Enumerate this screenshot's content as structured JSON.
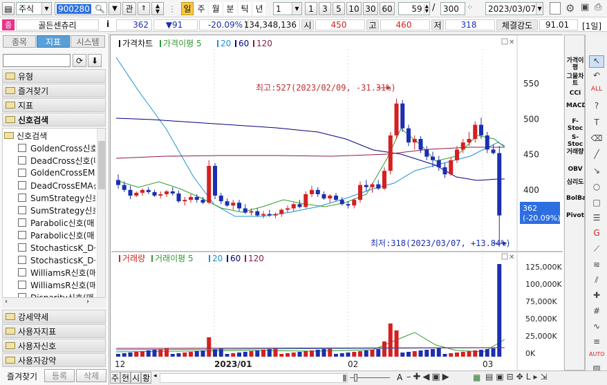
{
  "toolbar": {
    "market": "주식",
    "code": "900280",
    "btn_gwan": "관",
    "periods": [
      "일",
      "주",
      "월",
      "분",
      "틱",
      "년"
    ],
    "interval": "1",
    "quick_n": [
      "1",
      "3",
      "5",
      "10",
      "30",
      "60"
    ],
    "count": "59",
    "slash": "/",
    "total": "300",
    "date": "2023/03/07"
  },
  "quote": {
    "badge": "중",
    "name": "골든센츄리",
    "info": "i",
    "price": "362",
    "change": "▼91",
    "rate": "-20.09%",
    "volume": "134,348,136",
    "open_label": "시",
    "open": "450",
    "high_label": "고",
    "high": "460",
    "low_label": "저",
    "low": "318",
    "strength_label": "체결강도",
    "strength": "91.01",
    "period_tag": "[1일]"
  },
  "left": {
    "tabs": [
      "종목",
      "지표",
      "시스템"
    ],
    "folders_top": [
      "유형",
      "즐겨찾기",
      "지표",
      "신호검색"
    ],
    "tree_root": "신호검색",
    "tree_items": [
      "GoldenCross신호",
      "DeadCross신호(매",
      "GoldenCrossEMA",
      "DeadCrossEMA신",
      "SumStrategy신호",
      "SumStrategy신호",
      "Parabolic신호(매",
      "Parabolic신호(매",
      "StochasticsK_D신",
      "StochasticsK_D신",
      "WilliamsR신호(매",
      "WilliamsR신호(매",
      "Disparity신호(매"
    ],
    "folders_bottom": [
      "강세약세",
      "사용자지표",
      "사용자신호",
      "사용자강약"
    ],
    "bottom_tabs": [
      "즐겨찾기",
      "등록",
      "삭제"
    ]
  },
  "chart": {
    "legend_price": [
      {
        "label": "가격차트",
        "color": "#111111"
      },
      {
        "label": "가격이평 5",
        "color": "#2e9b2e"
      },
      {
        "label": "20",
        "color": "#1b8fd6"
      },
      {
        "label": "60",
        "color": "#000080"
      },
      {
        "label": "120",
        "color": "#8b1a4a"
      }
    ],
    "legend_vol": [
      {
        "label": "거래량",
        "color": "#d42020"
      },
      {
        "label": "거래이평 5",
        "color": "#2e9b2e"
      },
      {
        "label": "20",
        "color": "#1b8fd6"
      },
      {
        "label": "60",
        "color": "#000080"
      },
      {
        "label": "120",
        "color": "#8b1a4a"
      }
    ],
    "high_note": "최고:527(2023/02/09, -31.31%)",
    "low_note": "최저:318(2023/03/07, +13.84%)",
    "price_tag": "362",
    "rate_tag": "(-20.09%)",
    "price_axis": [
      "550",
      "500",
      "450",
      "400"
    ],
    "vol_axis": [
      "125,000K",
      "100,000K",
      "75,000K",
      "50,000K",
      "25,000K",
      "0K"
    ],
    "x_labels": [
      "12",
      "2023/01",
      "02",
      "03"
    ]
  },
  "right_indicators": [
    "가격이평",
    "그물차트",
    "CCI",
    "MACD",
    "F-Stoc",
    "S-Stoc",
    "거래량",
    "OBV",
    "심리도",
    "BolBand",
    "Pivot"
  ],
  "bottom_bar": {
    "tabs": [
      "주",
      "현",
      "시",
      "황"
    ],
    "a_label": "A"
  },
  "colors": {
    "up": "#d42020",
    "down": "#1b2fb0",
    "selected": "#2d6fe0"
  }
}
